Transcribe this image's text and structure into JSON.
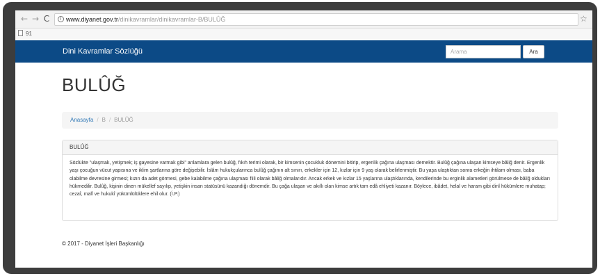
{
  "browser": {
    "back_glyph": "←",
    "forward_glyph": "→",
    "reload_glyph": "C",
    "url_host": "www.diyanet.gov.tr",
    "url_path": "/dinikavramlar/dinikavramlar-B/BULÛĞ",
    "bookmark_label": "91"
  },
  "navbar": {
    "brand": "Dini Kavramlar Sözlüğü",
    "search_placeholder": "Arama",
    "search_button": "Ara",
    "color": "#0c4a86"
  },
  "page": {
    "title": "BULÛĞ",
    "breadcrumb": {
      "home": "Anasayfa",
      "separator": "/",
      "letter": "B",
      "current": "BULÛĞ"
    },
    "panel": {
      "heading": "BULÛĞ",
      "body": "Sözlükte \"ulaşmak, yetişmek; iş gayesine varmak gibi\" anlamlara gelen bulûğ, fıkıh terimi olarak, bir kimsenin çocukluk dönemini bitirip, ergenlik çağına ulaşması demektir. Bulûğ çağına ulaşan kimseye bâliğ denir. Ergenlik yaşı çocuğun vücut yapısına ve iklim şartlarına göre değişebilir. İslâm hukukçularınca bulûğ çağının alt sınırı, erkekler için 12, kızlar için 9 yaş olarak belirlenmiştir. Bu yaşa ulaştıktan sonra erkeğin ihtilam olması, baba olabilme devresine girmesi; kızın da adet görmesi, gebe kalabilme çağına ulaşması fiili olarak bâliğ olmalarıdır. Ancak erkek ve kızlar 15 yaşlarına ulaştıklarında, kendilerinde bu erginlik alametleri görülmese de bâliğ oldukları hükmedilir. Bulûğ, kişinin dinen mükellef sayılıp, yetişkin insan statüsünü kazandığı dönemdir. Bu çağa ulaşan ve akıllı olan kimse artık tam edâ ehliyeti kazanır. Böylece, ibâdet, helal ve haram gibi dinî hükümlere muhatap; cezaî, malî ve hukukî yükümlülüklere ehil olur. (İ.P.)"
    },
    "footer": "© 2017 - Diyanet İşleri Başkanlığı"
  }
}
